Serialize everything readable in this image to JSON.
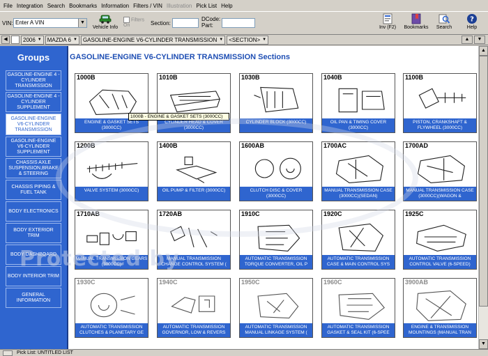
{
  "menu": [
    "File",
    "Integration",
    "Search",
    "Bookmarks",
    "Information",
    "Filters / VIN",
    "Illustration",
    "Pick List",
    "Help"
  ],
  "toolbar": {
    "vin_label": "VIN:",
    "vin_value": "Enter A VIN",
    "vehicle_info_label": "Vehicle Info",
    "filters_on_label": "Filters On",
    "section_label": "Section:",
    "dcode_label": "DCode:",
    "part_label": "Part:",
    "inv_label": "Inv (F2)",
    "bookmarks_label": "Bookmarks",
    "search_label": "Search",
    "help_label": "Help"
  },
  "breadcrumb": {
    "year": "2006",
    "model": "MAZDA 6",
    "group": "GASOLINE-ENGINE V6-CYLINDER TRANSMISSION",
    "section": "<SECTION>"
  },
  "sidebar": {
    "title": "Groups",
    "items": [
      {
        "label": "GASOLINE-ENGINE 4 -CYLINDER TRANSMISSION"
      },
      {
        "label": "GASOLINE-ENGINE 4 -CYLINDER SUPPLEMENT"
      },
      {
        "label": "GASOLINE-ENGINE V6-CYLINDER TRANSMISSION"
      },
      {
        "label": "GASOLINE-ENGINE V6-CYLINDER SUPPLEMENT"
      },
      {
        "label": "CHASSIS AXLE SUSPENSION,BRAKE & STEERING"
      },
      {
        "label": "CHASSIS PIPING & FUEL TANK"
      },
      {
        "label": "BODY ELECTRONICS"
      },
      {
        "label": "BODY EXTERIOR TRIM"
      },
      {
        "label": "BODY DASHBOARD"
      },
      {
        "label": "BODY INTERIOR TRIM"
      },
      {
        "label": "GENERAL INFORMATION"
      }
    ]
  },
  "main": {
    "title": "GASOLINE-ENGINE V6-CYLINDER TRANSMISSION Sections",
    "tooltip": "1000B - ENGINE & GASKET SETS (3000CC)",
    "sections": [
      {
        "code": "1000B",
        "caption": "ENGINE & GASKET SETS (3000CC)"
      },
      {
        "code": "1010B",
        "caption": "CYLINDER HEAD & COVER (3000CC)"
      },
      {
        "code": "1030B",
        "caption": "CYLINDER BLOCK (3000CC)"
      },
      {
        "code": "1040B",
        "caption": "OIL PAN & TIMING COVER (3000CC)"
      },
      {
        "code": "1100B",
        "caption": "PISTON, CRANKSHAFT & FLYWHEEL (3000CC)"
      },
      {
        "code": "1200B",
        "caption": "VALVE SYSTEM (3000CC)"
      },
      {
        "code": "1400B",
        "caption": "OIL PUMP & FILTER (3000CC)"
      },
      {
        "code": "1600AB",
        "caption": "CLUTCH DISC & COVER (3000CC)"
      },
      {
        "code": "1700AC",
        "caption": "MANUAL TRANSMISSION CASE (3000CC)(SEDAN)"
      },
      {
        "code": "1700AD",
        "caption": "MANUAL TRANSMISSION CASE (3000CC)(WAGON &"
      },
      {
        "code": "1710AB",
        "caption": "MANUAL TRANSMISSION GEARS (3000CC)"
      },
      {
        "code": "1720AB",
        "caption": "MANUAL TRANSMISSION CHANGE CONTROL SYSTEM ("
      },
      {
        "code": "1910C",
        "caption": "AUTOMATIC TRANSMISSION TORQUE CONVERTER, OIL P"
      },
      {
        "code": "1920C",
        "caption": "AUTOMATIC TRANSMISSION CASE & MAIN CONTROL SYS"
      },
      {
        "code": "1925C",
        "caption": "AUTOMATIC TRANSMISSION CONTROL VALVE (6-SPEED)"
      },
      {
        "code": "1930C",
        "caption": "AUTOMATIC TRANSMISSION CLUTCHES & PLANETARY GE"
      },
      {
        "code": "1940C",
        "caption": "AUTOMATIC TRANSMISSION GOVERNOR, LOW & REVERS"
      },
      {
        "code": "1950C",
        "caption": "AUTOMATIC TRANSMISSION MANUAL LINKAGE SYSTEM ("
      },
      {
        "code": "1960C",
        "caption": "AUTOMATIC TRANSMISSION GASKET & SEAL KIT (6-SPEE"
      },
      {
        "code": "3900AB",
        "caption": "ENGINE & TRANSMISSION MOUNTINGS (MANUAL TRAN"
      }
    ]
  },
  "watermark": "Protected by",
  "statusbar": {
    "pick_list": "Pick List: UNTITLED LIST"
  },
  "colors": {
    "accent": "#2f65cf",
    "title": "#1f4fb4"
  }
}
